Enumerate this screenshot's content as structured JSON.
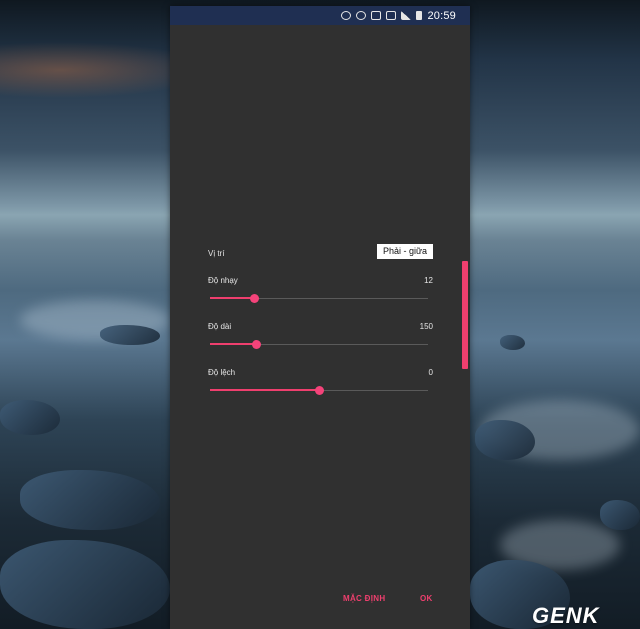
{
  "status_bar": {
    "time": "20:59",
    "icons": [
      "alarm-icon",
      "wifi-icon",
      "nfc-icon",
      "sim-signal-icon",
      "signal-icon",
      "battery-icon"
    ]
  },
  "settings": {
    "position": {
      "label": "Vị trí",
      "value": "Phải - giữa"
    },
    "sensitivity": {
      "label": "Độ nhạy",
      "value": "12",
      "level_percent": 20
    },
    "length": {
      "label": "Độ dài",
      "value": "150",
      "level_percent": 21
    },
    "offset": {
      "label": "Độ lệch",
      "value": "0",
      "level_percent": 50
    }
  },
  "buttons": {
    "default_label": "MẶC ĐỊNH",
    "ok_label": "OK"
  },
  "colors": {
    "accent": "#ef3f6e",
    "dialog_background": "#303030",
    "status_bar": "#1f2f52"
  },
  "watermark": "GENK"
}
